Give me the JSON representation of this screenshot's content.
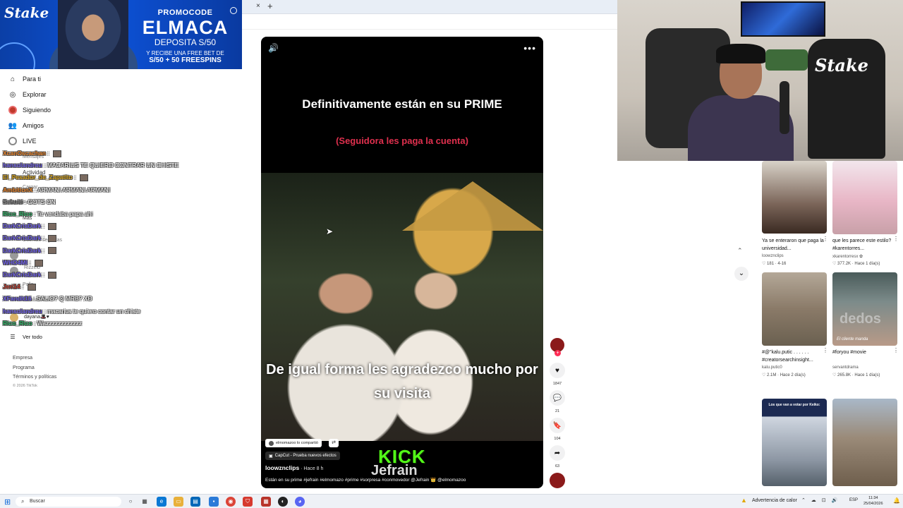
{
  "browser": {
    "close_glyph": "×",
    "new_tab_glyph": "+"
  },
  "promo": {
    "brand": "Stake",
    "code_label": "PROMOCODE",
    "code": "ELMACA",
    "deposit": "DEPOSITA S/50",
    "recibe": "Y RECIBE UNA FREE BET DE",
    "spins": "S/50 + 50 FREESPINS"
  },
  "sidebar": {
    "nav": [
      {
        "label": "Para ti",
        "icon": "home-icon"
      },
      {
        "label": "Explorar",
        "icon": "compass-icon"
      },
      {
        "label": "Siguiendo",
        "icon": "following-icon"
      },
      {
        "label": "Amigos",
        "icon": "friends-icon"
      },
      {
        "label": "LIVE",
        "icon": "live-icon"
      }
    ],
    "behind_items": [
      "Mensajes",
      "Actividad",
      "Cargar",
      "Perfil",
      "Más"
    ],
    "following": [
      "Cuentas seguidas",
      "Rizzelo",
      "Pollo",
      "Smallaholiks",
      "dayana🎩♥"
    ],
    "ver_todo": "Ver todo",
    "footer": [
      "Empresa",
      "Programa",
      "Términos y políticas"
    ],
    "copyright": "© 2026 TikTok"
  },
  "chat": [
    {
      "user": "XcanOscachan",
      "msg": "",
      "color": "#e67e22",
      "emote": true
    },
    {
      "user": "hansolandreu",
      "msg": "MACARIUS TE QUIERO CONTRAR UN CHISTE",
      "color": "#6c5ce7",
      "emote": false
    },
    {
      "user": "El_Pesador_de_Zapatito",
      "msg": "",
      "color": "#d4a017",
      "emote": true
    },
    {
      "user": "AmbitionX",
      "msg": "ARMANI ARMANI ARMANI",
      "color": "#e67e22",
      "emote": false
    },
    {
      "user": "Sahuiti",
      "msg": "GOTS ON",
      "color": "#888888",
      "emote": false
    },
    {
      "user": "Rico_Rico",
      "msg": "Te vendaba papa ahi",
      "color": "#27ae60",
      "emote": false
    },
    {
      "user": "DarkCrisDark",
      "msg": "",
      "color": "#6c5ce7",
      "emote": true
    },
    {
      "user": "DarkCrisDark",
      "msg": "",
      "color": "#6c5ce7",
      "emote": true
    },
    {
      "user": "DarkCrisDark",
      "msg": "",
      "color": "#6c5ce7",
      "emote": true
    },
    {
      "user": "WHO4MI",
      "msg": "",
      "color": "#6c5ce7",
      "emote": true
    },
    {
      "user": "DarkCrisDark",
      "msg": "",
      "color": "#6c5ce7",
      "emote": true
    },
    {
      "user": "Jeri14",
      "msg": "",
      "color": "#c0392b",
      "emote": true
    },
    {
      "user": "XFandit16",
      "msg": "SALIO? Q MRB? XD",
      "color": "#6c5ce7",
      "emote": false
    },
    {
      "user": "hansolandreu",
      "msg": "macarius te quiero contar un chiste",
      "color": "#6c5ce7",
      "emote": false
    },
    {
      "user": "Rico_Rico",
      "msg": "Wazzzzzzzzzzzz",
      "color": "#27ae60",
      "emote": false
    }
  ],
  "video": {
    "caption_top": "Definitivamente están en su PRIME",
    "caption_red": "(Seguidora les paga la cuenta)",
    "caption_bottom": "De igual forma les agradezco mucho por su visita",
    "shared_by": "elmomazoo lo compartió",
    "effect": "CapCut - Prueba nuevos efectos",
    "author": "loowznclips",
    "time": " · Hace 8 h",
    "description": "Están en su prime #jefrain #elmomazo #prime #sorpresa #conmovedor @Jefrain 👑 @elmomazoo",
    "watermark_brand": "KICK",
    "watermark_name": "Jefrain",
    "colors": {
      "red_caption": "#e0304e",
      "kick_green": "#53fc18"
    }
  },
  "actions": {
    "plus": "+",
    "likes": "1847",
    "comments": "21",
    "saves": "104",
    "shares": "63"
  },
  "cam": {
    "brand": "Stake"
  },
  "grid": [
    {
      "title": "Ya se enteraron que paga la universidad...",
      "author": "loowznclips",
      "meta": "♡ 181 · 4-16",
      "bg": "linear-gradient(180deg,#d8d2c8,#7a6458 60%,#3a2a22)"
    },
    {
      "title": "que les parece este estilo? #karentorres...",
      "author": "xkarentorresx ✿",
      "meta": "♡ 377.2K · Hace 1 día(s)",
      "bg": "linear-gradient(180deg,#f2e6ec,#e8b6c6 55%,#c8a0a8)"
    },
    {
      "title": "#@\"kalu.putic . . . . . . #creatorsearchinsight...",
      "author": "kalu.putic0",
      "meta": "♡ 2.1M · Hace 2 día(s)",
      "bg": "linear-gradient(180deg,#b4a898,#8a7a68 50%,#6a6050)"
    },
    {
      "title": "#foryou #movie",
      "author": "servantdrama",
      "meta": "♡ 265.8K · Hace 1 día(s)",
      "bg": "linear-gradient(180deg,#4a5b5a,#7c8b8a 40%,#b89a88)",
      "overlay_big": "dedos",
      "overlay_small": "El cliente manda"
    },
    {
      "title": "",
      "author": "",
      "meta": "",
      "bg": "linear-gradient(180deg,#1c2a52 0 20%,#cfd6e0 21%,#8d97a4 70%,#55606a)",
      "overlay_top": "Los que van a votar por Keiko:"
    },
    {
      "title": "",
      "author": "",
      "meta": "",
      "bg": "linear-gradient(180deg,#a9b8c8,#9a8a78 45%,#6e5e4c)"
    }
  ],
  "taskbar": {
    "search": "Buscar",
    "weather": "Advertencia de calor",
    "lang": "ESP",
    "time": "11:34",
    "date": "25/04/2026"
  }
}
